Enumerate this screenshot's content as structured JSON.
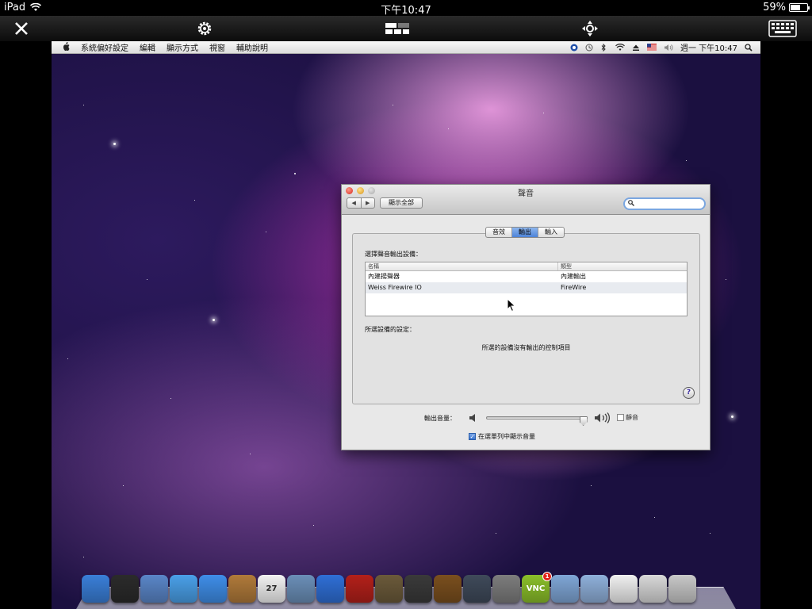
{
  "ipad_status": {
    "device": "iPad",
    "time": "下午10:47",
    "battery": "59%",
    "battery_level": 0.59
  },
  "vnc_toolbar": {
    "close_icon": "close-icon",
    "settings_icon": "gear-icon",
    "display_icon": "display-layout-icon",
    "move_icon": "move-arrows-icon",
    "keyboard_icon": "keyboard-icon"
  },
  "mac_menubar": {
    "app_name": "系統偏好設定",
    "menus": [
      "編輯",
      "顯示方式",
      "視窗",
      "輔助說明"
    ],
    "clock": "週一 下午10:47"
  },
  "window": {
    "title": "聲音",
    "show_all": "顯示全部",
    "search_placeholder": "",
    "tabs": [
      "音效",
      "輸出",
      "輸入"
    ],
    "active_tab": "輸出",
    "choose_device_label": "選擇聲音輸出設備：",
    "table": {
      "headers": [
        "名稱",
        "類型"
      ],
      "rows": [
        {
          "name": "內建揚聲器",
          "type": "內建輸出"
        },
        {
          "name": "Weiss Firewire IO",
          "type": "FireWire"
        }
      ],
      "selected_row": 1
    },
    "settings_label": "所選設備的設定：",
    "no_controls_text": "所選的設備沒有輸出的控制項目",
    "output_volume_label": "輸出音量：",
    "output_volume_level": 0.95,
    "mute_label": "靜音",
    "mute_checked": false,
    "show_volume_label": "在選單列中顯示音量",
    "show_volume_checked": true,
    "help": "?"
  },
  "dock": {
    "items": [
      {
        "name": "finder-icon",
        "color": "#3a7fd8"
      },
      {
        "name": "dashboard-icon",
        "color": "#2b2b2b"
      },
      {
        "name": "mail-stamp-icon",
        "color": "#5a86c8"
      },
      {
        "name": "safari-icon",
        "color": "#4aa0e8"
      },
      {
        "name": "ichat-icon",
        "color": "#3f8ee8"
      },
      {
        "name": "address-book-icon",
        "color": "#b07a3a"
      },
      {
        "name": "ical-icon",
        "color": "#f2f2f2",
        "label": "27"
      },
      {
        "name": "preview-icon",
        "color": "#6b8fb8"
      },
      {
        "name": "itunes-icon",
        "color": "#2f6fd6"
      },
      {
        "name": "photo-booth-icon",
        "color": "#b3201a"
      },
      {
        "name": "iphoto-icon",
        "color": "#6b5a3a"
      },
      {
        "name": "imovie-icon",
        "color": "#3a3a3a"
      },
      {
        "name": "garageband-icon",
        "color": "#7a4f1e"
      },
      {
        "name": "time-machine-icon",
        "color": "#3f4a5a"
      },
      {
        "name": "system-preferences-icon",
        "color": "#7d7d7d"
      },
      {
        "name": "server-vnc-icon",
        "color": "#8bbf2a",
        "label": "VNC",
        "badge": "1"
      },
      {
        "name": "applications-folder-icon",
        "color": "#7fa6d6"
      },
      {
        "name": "documents-folder-icon",
        "color": "#8fb0da"
      },
      {
        "name": "document-icon",
        "color": "#f0f0f0"
      },
      {
        "name": "image-stack-icon",
        "color": "#d8d8d8"
      },
      {
        "name": "trash-icon",
        "color": "#c8c8c8"
      }
    ]
  }
}
